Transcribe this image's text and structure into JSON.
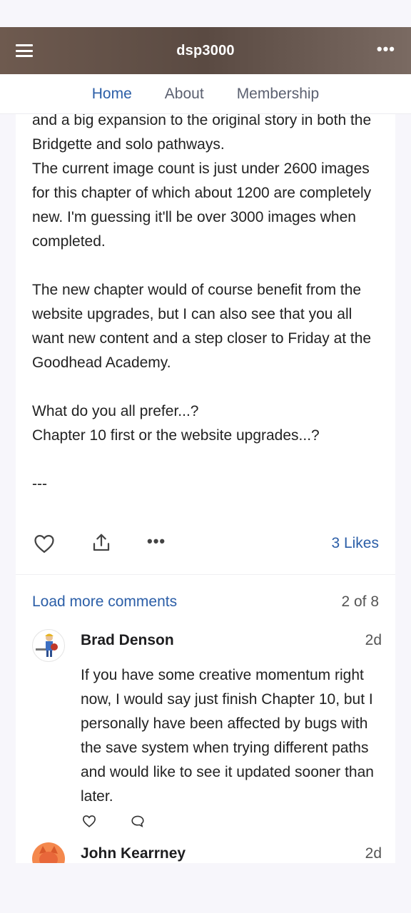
{
  "app": {
    "title": "dsp3000"
  },
  "tabs": [
    {
      "label": "Home",
      "active": true
    },
    {
      "label": "About",
      "active": false
    },
    {
      "label": "Membership",
      "active": false
    }
  ],
  "post": {
    "body": "and a big expansion to the original story in both the Bridgette and solo pathways.\nThe current image count is just under 2600 images for this chapter of which about 1200 are completely new. I'm guessing it'll be over 3000 images when completed.\n\nThe new chapter would of course benefit from the website upgrades, but I can also see that you all want new content and a step closer to Friday at the Goodhead Academy.\n\nWhat do you all prefer...?\nChapter 10 first or the website upgrades...?\n\n---",
    "likes_label": "3 Likes"
  },
  "comments_section": {
    "load_more_label": "Load more comments",
    "count_label": "2 of 8",
    "comments": [
      {
        "author": "Brad Denson",
        "age": "2d",
        "text": "If you have some creative momentum right now, I would say just finish Chapter 10, but I personally have been affected by bugs with the save system when trying different paths and would like to see it updated sooner than later."
      },
      {
        "author": "John Kearrney",
        "age": "2d",
        "text": ""
      }
    ]
  },
  "icons": {
    "menu": "hamburger-icon",
    "overflow": "more-icon",
    "like": "heart-icon",
    "share": "share-icon",
    "reply": "comment-icon"
  },
  "colors": {
    "accent": "#2b5ea7",
    "appbar": "#5a4a42"
  }
}
